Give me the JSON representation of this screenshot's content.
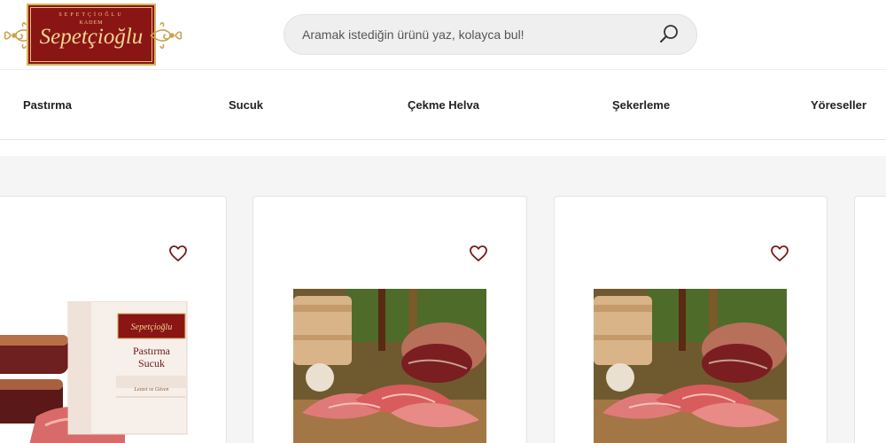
{
  "brand": {
    "small_text": "SEPETÇİOĞLU",
    "sub_text": "KADEM",
    "name": "Sepetçioğlu",
    "colors": {
      "plate": "#8a1515",
      "gold": "#d9b35e"
    }
  },
  "search": {
    "placeholder": "Aramak istediğin ürünü yaz, kolayca bul!",
    "icon": "search-icon"
  },
  "nav": {
    "items": [
      {
        "label": "Pastırma"
      },
      {
        "label": "Sucuk"
      },
      {
        "label": "Çekme Helva"
      },
      {
        "label": "Şekerleme"
      },
      {
        "label": "Yöreseller"
      }
    ]
  },
  "products": [
    {
      "image": "pastirma-sucuk-package",
      "package_brand": "Sepetçioğlu",
      "package_line1": "Pastırma",
      "package_line2": "Sucuk",
      "package_footer": "Lezzet ve Güven",
      "favorite_icon": "heart-icon"
    },
    {
      "image": "pastirma-slices-board",
      "favorite_icon": "heart-icon"
    },
    {
      "image": "pastirma-slices-board",
      "favorite_icon": "heart-icon"
    }
  ]
}
